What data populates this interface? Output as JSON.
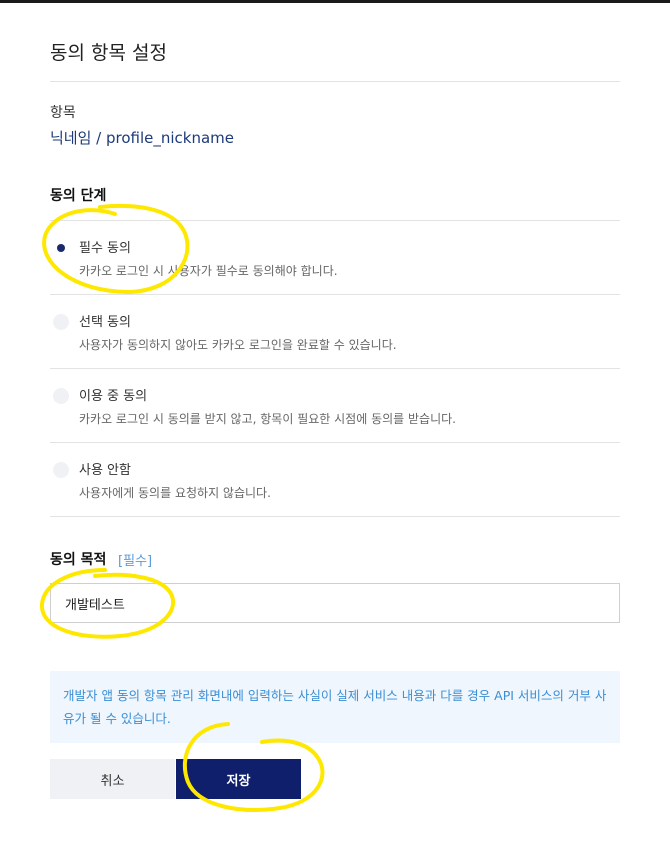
{
  "page": {
    "title": "동의 항목 설정"
  },
  "item": {
    "label": "항목",
    "value": "닉네임 / profile_nickname"
  },
  "consent_level": {
    "title": "동의 단계",
    "options": [
      {
        "label": "필수 동의",
        "description": "카카오 로그인 시 사용자가 필수로 동의해야 합니다.",
        "selected": true
      },
      {
        "label": "선택 동의",
        "description": "사용자가 동의하지 않아도 카카오 로그인을 완료할 수 있습니다.",
        "selected": false
      },
      {
        "label": "이용 중 동의",
        "description": "카카오 로그인 시 동의를 받지 않고, 항목이 필요한 시점에 동의를 받습니다.",
        "selected": false
      },
      {
        "label": "사용 안함",
        "description": "사용자에게 동의를 요청하지 않습니다.",
        "selected": false
      }
    ]
  },
  "purpose": {
    "title": "동의 목적",
    "required_tag": "[필수]",
    "value": "개발테스트"
  },
  "notice": {
    "text": "개발자 앱 동의 항목 관리 화면내에 입력하는 사실이 실제 서비스 내용과 다를 경우 API 서비스의 거부 사유가 될 수 있습니다."
  },
  "buttons": {
    "cancel": "취소",
    "save": "저장"
  },
  "colors": {
    "accent": "#0f1f6b",
    "notice_text": "#3b8ed3",
    "notice_bg": "#eff6fd",
    "highlight": "#ffe800"
  }
}
